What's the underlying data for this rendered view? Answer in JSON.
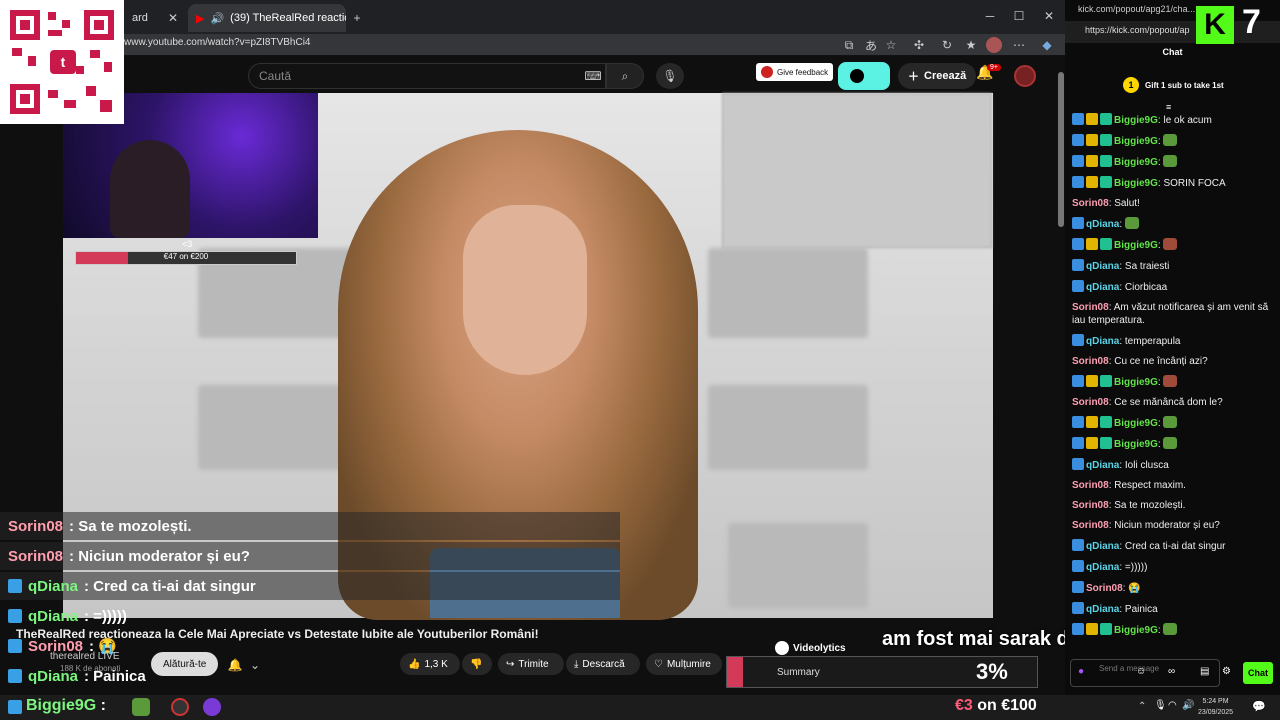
{
  "browser": {
    "tabs": [
      {
        "title": "ard"
      },
      {
        "title": "(39) TheRealRed reactioneaz"
      }
    ],
    "url": "www.youtube.com/watch?v=pZI8TVBhCi4",
    "new_tab": "+",
    "minimize": "─",
    "maximize": "☐",
    "close": "✕"
  },
  "youtube": {
    "search_placeholder": "Caută",
    "feedback_label": "Give feedback",
    "create_label": "Creează",
    "notif_count": "9+",
    "video_title": "TheRealRed reactioneaza la Cele Mai Apreciate vs Detestate Iubite ale Youtuberilor Români!",
    "channel_name": "therealred LIVE",
    "subscribers": "188 K de abonați",
    "join_label": "Alătură-te",
    "like_count": "1,3 K",
    "share_label": "Trimite",
    "download_label": "Descarcă",
    "thanks_label": "Mulțumire",
    "videolytics_label": "Videolytics",
    "summary_label": "Summary"
  },
  "stream_overlay": {
    "goal_text": "€47 on €200",
    "percent": "3%",
    "caption": "am fost mai sarak de atatah",
    "goal2_amount": "€3",
    "goal2_suffix": " on €100",
    "chat_lines": [
      {
        "name": "Sorin08",
        "text": ": Sa te mozolești.",
        "type": "pink"
      },
      {
        "name": "Sorin08",
        "text": ": Niciun moderator și eu?",
        "type": "pink"
      },
      {
        "name": "qDiana",
        "text": ": Cred ca ti-ai dat singur",
        "type": "green"
      },
      {
        "name": "qDiana",
        "text": ": =)))))",
        "type": "green"
      },
      {
        "name": "Sorin08",
        "text": ": 😭",
        "type": "pink"
      },
      {
        "name": "qDiana",
        "text": ": Painica",
        "type": "green"
      }
    ],
    "bottom_name": "Biggie9G",
    "bottom_text": " :"
  },
  "kick": {
    "tab_title": "kick.com/popout/apg21/cha...",
    "url": "https://kick.com/popout/ap",
    "logo_letter": "K",
    "overlay_number": "7",
    "chat_title": "Chat",
    "gift_text": "Gift 1 sub to take 1st",
    "gift_badge": "1",
    "input_placeholder": "Send a message",
    "chat_button": "Chat",
    "messages": [
      {
        "name": "Biggie9G",
        "text": " le ok acum",
        "color": "g",
        "badges": 3,
        "emote": ""
      },
      {
        "name": "Biggie9G",
        "text": "",
        "color": "g",
        "badges": 3,
        "emote": "g"
      },
      {
        "name": "Biggie9G",
        "text": "",
        "color": "g",
        "badges": 3,
        "emote": "g"
      },
      {
        "name": "Biggie9G",
        "text": " SORIN FOCA",
        "color": "g",
        "badges": 3,
        "emote": ""
      },
      {
        "name": "Sorin08",
        "text": " Salut!",
        "color": "p",
        "badges": 0,
        "emote": ""
      },
      {
        "name": "qDiana",
        "text": "",
        "color": "c",
        "badges": 1,
        "emote": "g"
      },
      {
        "name": "Biggie9G",
        "text": "",
        "color": "g",
        "badges": 3,
        "emote": "r"
      },
      {
        "name": "qDiana",
        "text": " Sa traiesti",
        "color": "c",
        "badges": 1,
        "emote": ""
      },
      {
        "name": "qDiana",
        "text": " Ciorbicaa",
        "color": "c",
        "badges": 1,
        "emote": ""
      },
      {
        "name": "Sorin08",
        "text": " Am văzut notificarea și am venit să iau temperatura.",
        "color": "p",
        "badges": 0,
        "emote": ""
      },
      {
        "name": "qDiana",
        "text": " temperapula",
        "color": "c",
        "badges": 1,
        "emote": ""
      },
      {
        "name": "Sorin08",
        "text": " Cu ce ne încânți azi?",
        "color": "p",
        "badges": 0,
        "emote": ""
      },
      {
        "name": "Biggie9G",
        "text": "",
        "color": "g",
        "badges": 3,
        "emote": "r"
      },
      {
        "name": "Sorin08",
        "text": " Ce se mănâncă dom le?",
        "color": "p",
        "badges": 0,
        "emote": ""
      },
      {
        "name": "Biggie9G",
        "text": "",
        "color": "g",
        "badges": 3,
        "emote": "g"
      },
      {
        "name": "Biggie9G",
        "text": "",
        "color": "g",
        "badges": 3,
        "emote": "g"
      },
      {
        "name": "qDiana",
        "text": " Ioli clusca",
        "color": "c",
        "badges": 1,
        "emote": ""
      },
      {
        "name": "Sorin08",
        "text": " Respect maxim.",
        "color": "p",
        "badges": 0,
        "emote": ""
      },
      {
        "name": "Sorin08",
        "text": " Sa te mozolești.",
        "color": "p",
        "badges": 0,
        "emote": ""
      },
      {
        "name": "Sorin08",
        "text": " Niciun moderator și eu?",
        "color": "p",
        "badges": 0,
        "emote": ""
      },
      {
        "name": "qDiana",
        "text": " Cred ca ti-ai dat singur",
        "color": "c",
        "badges": 1,
        "emote": ""
      },
      {
        "name": "qDiana",
        "text": " =)))))",
        "color": "c",
        "badges": 1,
        "emote": ""
      },
      {
        "name": "Sorin08",
        "text": " 😭",
        "color": "p",
        "badges": 1,
        "emote": ""
      },
      {
        "name": "qDiana",
        "text": " Painica",
        "color": "c",
        "badges": 1,
        "emote": ""
      },
      {
        "name": "Biggie9G",
        "text": "",
        "color": "g",
        "badges": 3,
        "emote": "g"
      }
    ]
  },
  "taskbar": {
    "time": "5:24 PM",
    "date": "23/09/2025"
  },
  "colors": {
    "kick_green": "#53fc18",
    "yt_red": "#cc0000",
    "accent_pink": "#d33a5a"
  }
}
